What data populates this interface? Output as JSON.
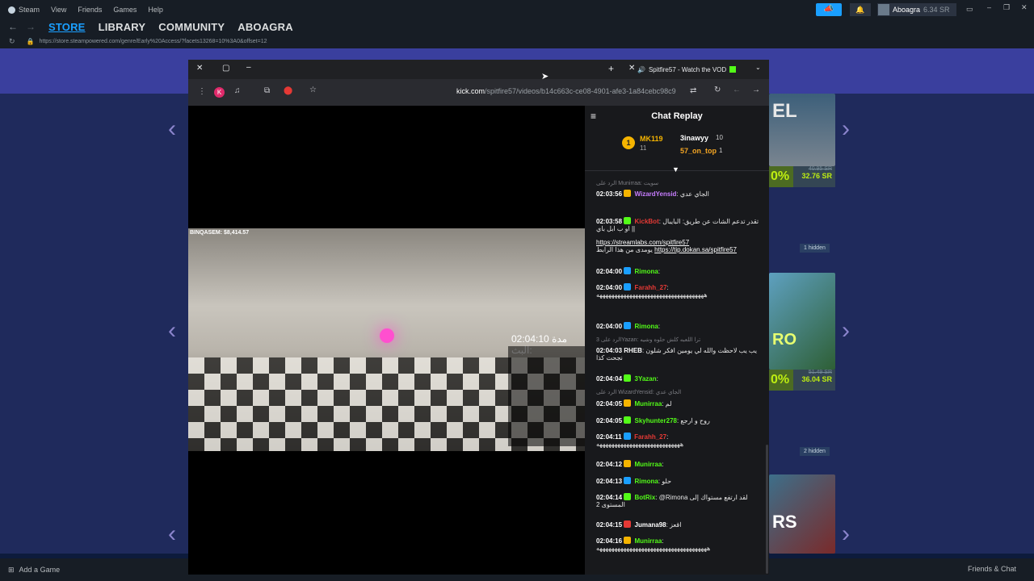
{
  "steam": {
    "app": "Steam",
    "menu": [
      "View",
      "Friends",
      "Games",
      "Help"
    ],
    "nav": [
      "STORE",
      "LIBRARY",
      "COMMUNITY",
      "ABOAGRA"
    ],
    "url": "https://store.steampowered.com/genre/Early%20Access/?facets13268=10%3A0&offset=12",
    "user": "Aboagra",
    "wallet": "6.34 SR",
    "bottom_left": "Add a Game",
    "bottom_right": "Friends & Chat",
    "tiles": [
      {
        "discount": "0%",
        "old": "40.95 SR",
        "new": "32.76 SR",
        "label": "EL"
      },
      {
        "discount": "0%",
        "old": "51.49 SR",
        "new": "36.04 SR",
        "label": "RO"
      },
      {
        "label": "RS"
      }
    ],
    "hidden": [
      "1 hidden",
      "2 hidden"
    ]
  },
  "browser": {
    "tab_title": "Spitfire57 - Watch the VOD",
    "url_domain": "kick.com",
    "url_path": "/spitfire57/videos/b14c663c-ce08-4901-afe3-1a84cebc98c9",
    "avatar_letter": "K"
  },
  "video": {
    "streamer_label": "BINQASEM: $8,414.57",
    "timer": "02:04:10",
    "timer_label": "مدة البث:"
  },
  "chat": {
    "title": "Chat Replay",
    "leaders": [
      {
        "rank": "1",
        "name": "MK119",
        "count": "11"
      },
      {
        "name": "3inawyy",
        "count": "10"
      },
      {
        "name": "57_on_top",
        "count": "1"
      }
    ],
    "messages": [
      {
        "reply": "الرد على Munirraa: سويت",
        "time": "",
        "user": "",
        "text": ""
      },
      {
        "time": "02:03:56",
        "user": "WizardYensid",
        "color": "#c77dff",
        "text": "الجاي عدي"
      },
      {
        "time": "02:03:58",
        "user": "KickBot",
        "color": "#e53935",
        "text": "تقدر تدعم الشات عن طريق: البايبال او ب ابل باي ||"
      },
      {
        "link1": "https://streamlabs.com/spitfire57",
        "link2": "https://tip.dokan.sa/spitfire57",
        "text2": "يومدى من هذا الرابط"
      },
      {
        "time": "02:04:00",
        "user": "Rimona",
        "color": "#53fc18",
        "text": ""
      },
      {
        "time": "02:04:00",
        "user": "Farahh_27",
        "color": "#e53935",
        "text": "ههههههههههههههههههههههههههههههههههههه"
      },
      {
        "time": "02:04:00",
        "user": "Rimona",
        "color": "#53fc18",
        "text": ""
      },
      {
        "reply": "الرد على 3Yazan: ترا اللعبه كلش حلوه وشيه"
      },
      {
        "time": "02:04:03",
        "user": "RHEB",
        "color": "#ffffff",
        "text": "يب يب لاحظت والله لي يومين افكر شلون نجحت كذا"
      },
      {
        "time": "02:04:04",
        "user": "3Yazan",
        "color": "#53fc18",
        "text": ""
      },
      {
        "reply": "الرد على WizardYensid: الجاي عدي"
      },
      {
        "time": "02:04:05",
        "user": "Munirraa",
        "color": "#53fc18",
        "text": "لم"
      },
      {
        "time": "02:04:05",
        "user": "Skyhunter278",
        "color": "#53fc18",
        "text": "روح و ارجع"
      },
      {
        "time": "02:04:11",
        "user": "Farahh_27",
        "color": "#e53935",
        "text": "ههههههههههههههههههههههههههههه"
      },
      {
        "time": "02:04:12",
        "user": "Munirraa",
        "color": "#53fc18",
        "text": ""
      },
      {
        "time": "02:04:13",
        "user": "Rimona",
        "color": "#53fc18",
        "text": "حلو"
      },
      {
        "time": "02:04:14",
        "user": "BotRix",
        "color": "#53fc18",
        "text": "@Rimona لقد ارتفع مستواك إلى المستوى 2"
      },
      {
        "time": "02:04:15",
        "user": "Jumana98",
        "color": "#ffffff",
        "text": "اقعز"
      },
      {
        "time": "02:04:16",
        "user": "Munirraa",
        "color": "#53fc18",
        "text": "هههههههههههههههههههههههههههههههههههههه"
      }
    ]
  },
  "colors": {
    "kick_green": "#53fc18",
    "steam_blue": "#1a9fff"
  }
}
